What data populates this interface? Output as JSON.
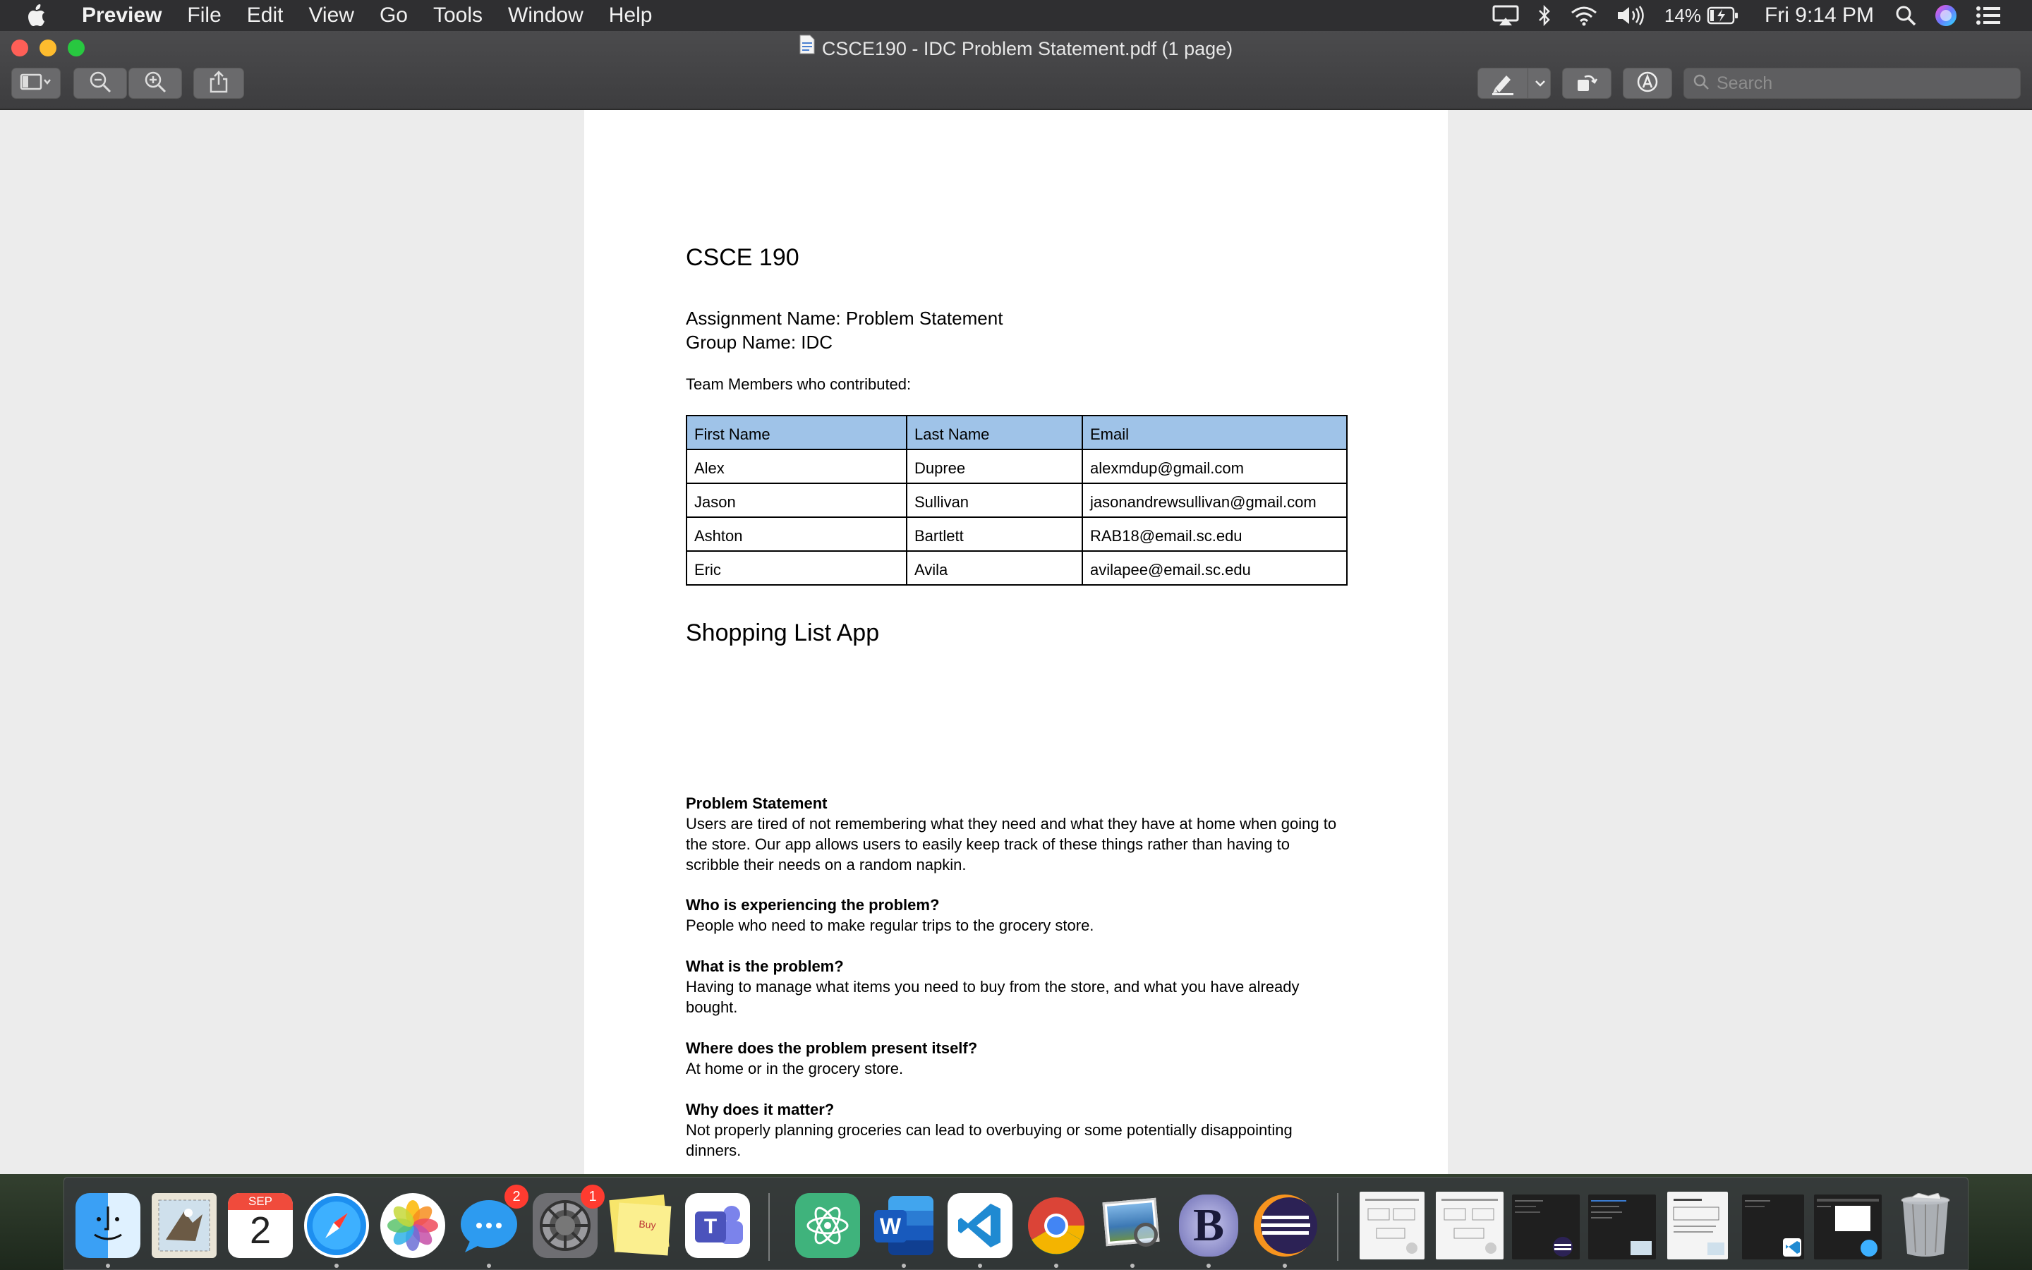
{
  "menubar": {
    "app_name": "Preview",
    "menus": [
      "File",
      "Edit",
      "View",
      "Go",
      "Tools",
      "Window",
      "Help"
    ],
    "battery_percent": "14%",
    "clock": "Fri 9:14 PM"
  },
  "window": {
    "title": "CSCE190 - IDC Problem Statement.pdf (1 page)",
    "search_placeholder": "Search"
  },
  "document": {
    "course": "CSCE 190",
    "assignment": "Assignment Name: Problem Statement",
    "group": "Group Name: IDC",
    "team_label": "Team Members who contributed:",
    "table": {
      "headers": [
        "First Name",
        "Last Name",
        "Email"
      ],
      "rows": [
        [
          "Alex",
          "Dupree",
          "alexmdup@gmail.com"
        ],
        [
          "Jason",
          "Sullivan",
          "jasonandrewsullivan@gmail.com"
        ],
        [
          "Ashton",
          "Bartlett",
          "RAB18@email.sc.edu"
        ],
        [
          "Eric",
          "Avila",
          "avilapee@email.sc.edu"
        ]
      ]
    },
    "app_title": "Shopping List App",
    "sections": [
      {
        "heading": "Problem Statement",
        "lines": [
          "Users are tired of not remembering what they need and what they have at home when going to",
          "the store. Our app allows users to easily keep track of these things rather than having to",
          "scribble their needs on a random napkin."
        ]
      },
      {
        "heading": "Who is experiencing the problem?",
        "lines": [
          "People who need to make regular trips to the grocery store."
        ]
      },
      {
        "heading": "What is the problem?",
        "lines": [
          "Having to manage what items you need to buy from the store, and what you have already",
          "bought."
        ]
      },
      {
        "heading": "Where does the problem present itself?",
        "lines": [
          "At home or in the grocery store."
        ]
      },
      {
        "heading": "Why does it matter?",
        "lines": [
          "Not properly planning groceries can lead to overbuying or some potentially disappointing",
          "dinners."
        ]
      }
    ]
  },
  "dock": {
    "calendar_month": "SEP",
    "calendar_day": "2",
    "messages_badge": "2",
    "system_prefs_badge": "1",
    "stickies_text": "Buy",
    "word_letter": "W",
    "teams_letter": "T",
    "bbedit_letter": "B"
  },
  "colors": {
    "table_header": "#9fc3e8",
    "menubar": "#2f2f31",
    "badge": "#ff3b30"
  }
}
